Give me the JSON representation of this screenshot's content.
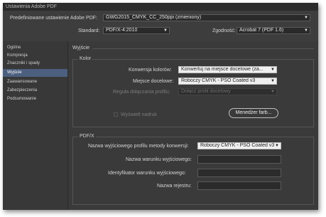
{
  "window": {
    "title": "Ustawienia Adobe PDF"
  },
  "header": {
    "preset_label": "Predefiniowane ustawienie Adobe PDF:",
    "preset_value": "GWG2015_CMYK_CC_250ppi (zmieniony)",
    "standard_label": "Standard:",
    "standard_value": "PDF/X-4:2010",
    "compat_label": "Zgodność:",
    "compat_value": "Acrobat 7 (PDF 1.6)"
  },
  "sidebar": {
    "items": [
      {
        "label": "Ogólne"
      },
      {
        "label": "Kompresja"
      },
      {
        "label": "Znaczniki i spady"
      },
      {
        "label": "Wyjście"
      },
      {
        "label": "Zaawansowane"
      },
      {
        "label": "Zabezpieczenia"
      },
      {
        "label": "Podsumowanie"
      }
    ],
    "active_index": 3
  },
  "output": {
    "section_title": "Wyjście",
    "color": {
      "group_title": "Kolor",
      "conversion_label": "Konwersja kolorów:",
      "conversion_value": "Konwertuj na miejsce docelowe (za...",
      "destination_label": "Miejsce docelowe:",
      "destination_value": "Roboczy CMYK - PSO Coated v3",
      "profile_policy_label": "Reguła dołączania profilu:",
      "profile_policy_value": "Dołącz profil docelowy",
      "simulate_overprint_label": "Wyświetl nadruk",
      "ink_manager_button": "Menedżer farb..."
    },
    "pdfx": {
      "group_title": "PDF/X",
      "output_intent_label": "Nazwa wyjściowego profilu metody konwersji:",
      "output_intent_value": "Roboczy CMYK - PSO Coated v3",
      "condition_name_label": "Nazwa warunku wyjściowego:",
      "condition_name_value": "",
      "condition_id_label": "Identyfikator warunku wyjściowego:",
      "condition_id_value": "",
      "registry_label": "Nazwa rejestru:",
      "registry_value": ""
    }
  },
  "colors": {
    "window_bg": "#3a3a3a",
    "active_item": "#4c5f7f"
  }
}
